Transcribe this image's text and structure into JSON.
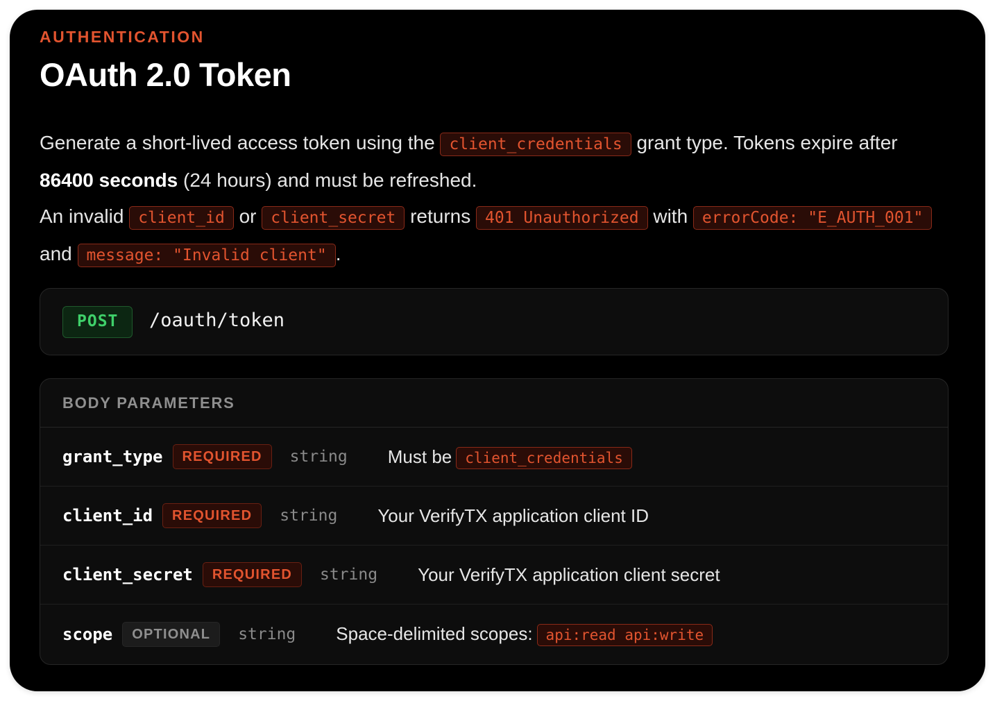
{
  "section": "AUTHENTICATION",
  "title": "OAuth 2.0 Token",
  "description": {
    "p1_a": "Generate a short-lived access token using the ",
    "p1_code": "client_credentials",
    "p1_b": " grant type. Tokens expire after ",
    "p1_bold": "86400 seconds",
    "p1_c": " (24 hours) and must be refreshed.",
    "p2_a": "An invalid ",
    "p2_code1": "client_id",
    "p2_b": " or ",
    "p2_code2": "client_secret",
    "p2_c": " returns ",
    "p2_code3": "401 Unauthorized",
    "p2_d": " with ",
    "p2_code4": "errorCode: \"E_AUTH_001\"",
    "p2_e": " and ",
    "p2_code5": "message: \"Invalid client\"",
    "p2_f": "."
  },
  "endpoint": {
    "method": "POST",
    "path": "/oauth/token"
  },
  "params": {
    "heading": "BODY PARAMETERS",
    "rows": [
      {
        "name": "grant_type",
        "badge": "REQUIRED",
        "type": "string",
        "desc": "Must be",
        "code": "client_credentials"
      },
      {
        "name": "client_id",
        "badge": "REQUIRED",
        "type": "string",
        "desc": "Your VerifyTX application client ID",
        "code": ""
      },
      {
        "name": "client_secret",
        "badge": "REQUIRED",
        "type": "string",
        "desc": "Your VerifyTX application client secret",
        "code": ""
      },
      {
        "name": "scope",
        "badge": "OPTIONAL",
        "type": "string",
        "desc": "Space-delimited scopes:",
        "code": "api:read api:write"
      }
    ]
  },
  "colors": {
    "accent": "#e2542f",
    "method_green": "#3fd06a",
    "card_bg": "#000000"
  }
}
